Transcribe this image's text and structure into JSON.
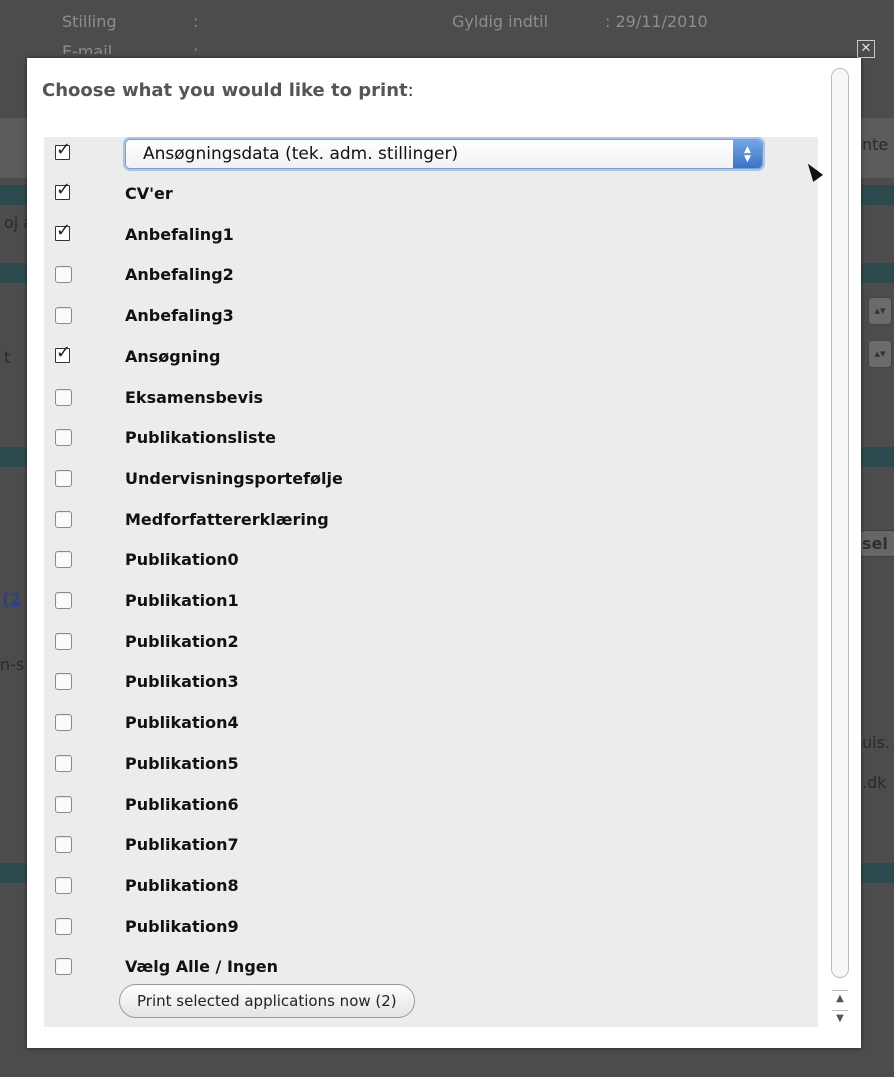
{
  "background": {
    "field1_label": "Stilling",
    "field1_sep": ":",
    "field2_label": "Gyldig indtil",
    "field2_value": ": 29/11/2010",
    "field3_label": "E-mail",
    "field3_sep": ":",
    "right_text1": "nte",
    "left_text1": "oj a",
    "left_text2": "t",
    "right_btn": "sel",
    "link_text": "(2",
    "left_text3": "n-s",
    "right_text2": "uis.",
    "right_text3": ".dk"
  },
  "modal": {
    "title": "Choose what you would like to print",
    "title_colon": ":",
    "select": {
      "value": "Ansøgningsdata (tek. adm. stillinger)",
      "checked": true
    },
    "items": [
      {
        "label": "CV'er",
        "checked": true
      },
      {
        "label": "Anbefaling1",
        "checked": true
      },
      {
        "label": "Anbefaling2",
        "checked": false
      },
      {
        "label": "Anbefaling3",
        "checked": false
      },
      {
        "label": "Ansøgning",
        "checked": true
      },
      {
        "label": "Eksamensbevis",
        "checked": false
      },
      {
        "label": "Publikationsliste",
        "checked": false
      },
      {
        "label": "Undervisningsportefølje",
        "checked": false
      },
      {
        "label": "Medforfattererklæring",
        "checked": false
      },
      {
        "label": "Publikation0",
        "checked": false
      },
      {
        "label": "Publikation1",
        "checked": false
      },
      {
        "label": "Publikation2",
        "checked": false
      },
      {
        "label": "Publikation3",
        "checked": false
      },
      {
        "label": "Publikation4",
        "checked": false
      },
      {
        "label": "Publikation5",
        "checked": false
      },
      {
        "label": "Publikation6",
        "checked": false
      },
      {
        "label": "Publikation7",
        "checked": false
      },
      {
        "label": "Publikation8",
        "checked": false
      },
      {
        "label": "Publikation9",
        "checked": false
      },
      {
        "label": "Vælg Alle / Ingen",
        "checked": false
      }
    ],
    "print_button": "Print selected applications now (2)"
  },
  "icons": {
    "close": "close-icon",
    "checkbox": "checkbox-icon",
    "select_arrows": "select-arrows-icon",
    "scroll_up": "scroll-up-arrow-icon",
    "scroll_down": "scroll-down-arrow-icon"
  }
}
